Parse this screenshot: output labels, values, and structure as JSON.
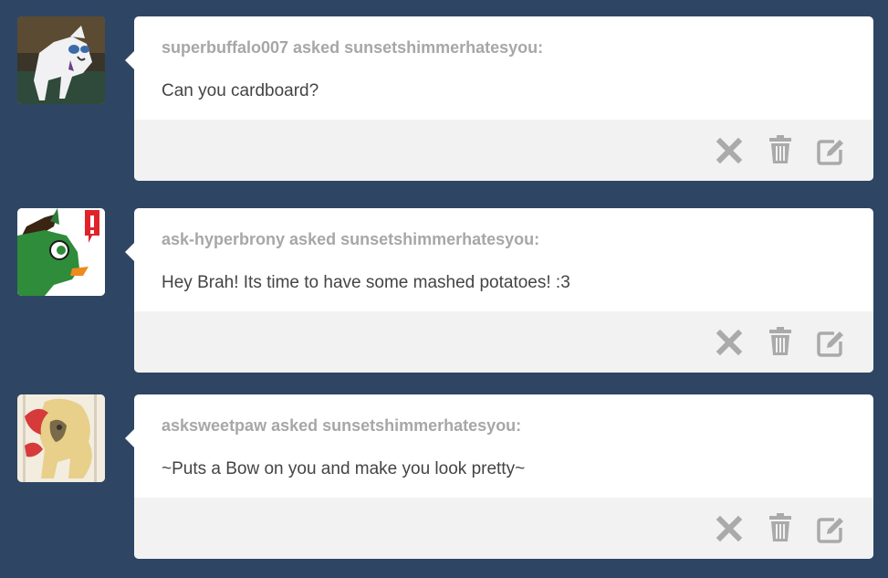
{
  "colors": {
    "background": "#2e4663",
    "card": "#ffffff",
    "footer": "#f2f2f2",
    "asker_text": "#a7a7a7",
    "question_text": "#444444",
    "icon": "#aaaaaa"
  },
  "posts": [
    {
      "asker_line": "superbuffalo007 asked sunsetshimmerhatesyou:",
      "question": "Can you cardboard?",
      "avatar": "white-pony-avatar",
      "actions": [
        "close-icon",
        "trash-icon",
        "edit-icon"
      ]
    },
    {
      "asker_line": "ask-hyperbrony asked sunsetshimmerhatesyou:",
      "question": "Hey Brah! Its time to have some mashed potatoes! :3",
      "avatar": "green-pony-avatar",
      "actions": [
        "close-icon",
        "trash-icon",
        "edit-icon"
      ]
    },
    {
      "asker_line": "asksweetpaw asked sunsetshimmerhatesyou:",
      "question": "~Puts a Bow on you and make you look pretty~",
      "avatar": "cream-pony-avatar",
      "actions": [
        "close-icon",
        "trash-icon",
        "edit-icon"
      ]
    }
  ]
}
